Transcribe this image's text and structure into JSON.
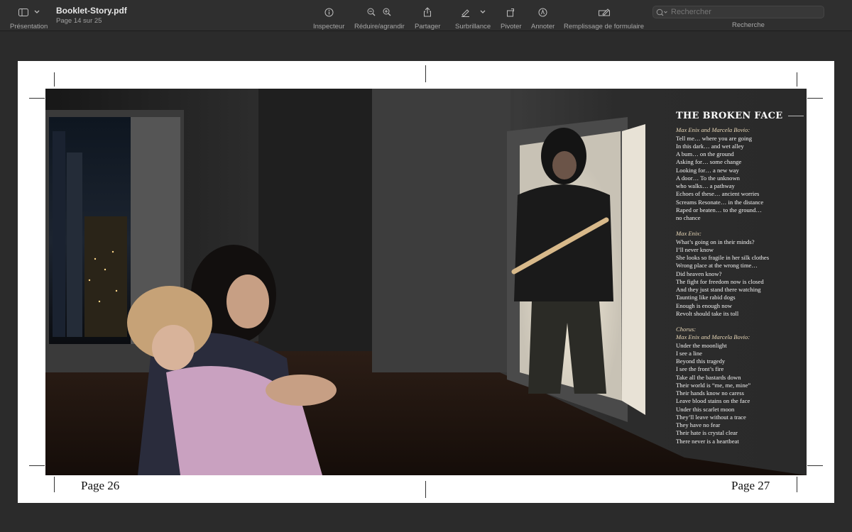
{
  "toolbar": {
    "presentation_label": "Présentation",
    "doc_name": "Booklet-Story.pdf",
    "doc_page": "Page 14 sur 25",
    "inspector_label": "Inspecteur",
    "zoom_label": "Réduire/agrandir",
    "share_label": "Partager",
    "highlight_label": "Surbrillance",
    "rotate_label": "Pivoter",
    "annotate_label": "Annoter",
    "form_label": "Remplissage de formulaire",
    "search_placeholder": "Rechercher",
    "search_label": "Recherche"
  },
  "document": {
    "song_title": "THE BROKEN FACE",
    "stanzas": [
      {
        "credit": "Max Enix and Marcela Bovio:",
        "lines": [
          "Tell me… where you are going",
          "In this dark… and wet alley",
          "A bum… on the ground",
          "Asking for… some change",
          "Looking for… a new way",
          "A door… To the unknown",
          "who walks… a pathway",
          "Echoes of these… ancient worries",
          "Screams Resonate… in the distance",
          "Raped or beaten… to the ground…",
          "no chance"
        ]
      },
      {
        "credit": "Max Enix:",
        "lines": [
          "What’s going on in their minds?",
          " I’ll never know",
          "She looks so fragile in her silk clothes",
          "Wrong place at the wrong time…",
          "Did heaven know?",
          "The fight for freedom now is closed",
          "And they just stand there watching",
          "Taunting like rabid dogs",
          "Enough is enough now",
          "Revolt should take its toll"
        ]
      },
      {
        "credit": "Chorus:",
        "credit2": "Max Enix and Marcela Bovio:",
        "lines": [
          "Under the moonlight",
          "I see a line",
          "Beyond this tragedy",
          "I see the front’s fire",
          "Take all the bastards down",
          "Their world is “me, me, mine”",
          "Their hands know no caress",
          "Leave blood stains on the face",
          "Under this scarlet moon",
          "They’ll leave without a trace",
          "They have no fear",
          "Their hate is crystal clear",
          "There never is a heartbeat"
        ]
      }
    ],
    "page_left": "Page 26",
    "page_right": "Page 27"
  }
}
